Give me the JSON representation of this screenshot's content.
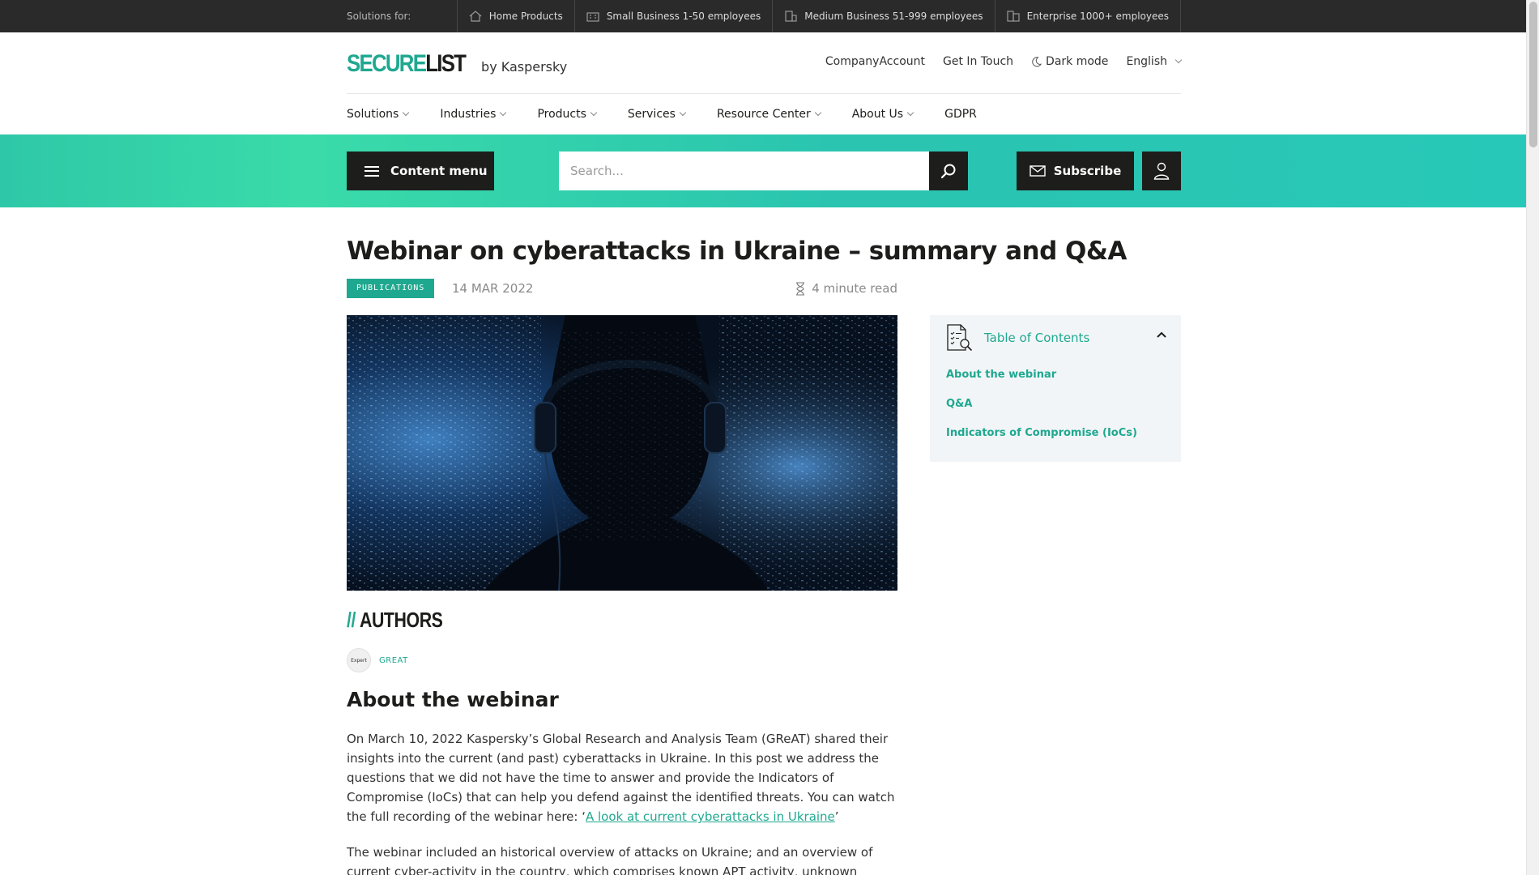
{
  "topbar": {
    "label": "Solutions for:",
    "items": [
      {
        "label": "Home Products",
        "icon": "house-icon"
      },
      {
        "label": "Small Business 1-50 employees",
        "icon": "building-small-icon"
      },
      {
        "label": "Medium Business 51-999 employees",
        "icon": "building-medium-icon"
      },
      {
        "label": "Enterprise 1000+ employees",
        "icon": "building-large-icon"
      }
    ]
  },
  "header": {
    "logo_part1": "SECURE",
    "logo_part2": "LIST",
    "logo_by": "by Kaspersky",
    "links": {
      "company_account": "CompanyAccount",
      "get_in_touch": "Get In Touch",
      "dark_mode": "Dark mode",
      "language": "English"
    }
  },
  "nav": {
    "items": [
      "Solutions",
      "Industries",
      "Products",
      "Services",
      "Resource Center",
      "About Us",
      "GDPR"
    ]
  },
  "toolbar": {
    "content_menu": "Content menu",
    "search_placeholder": "Search...",
    "subscribe": "Subscribe"
  },
  "article": {
    "title": "Webinar on cyberattacks in Ukraine – summary and Q&A",
    "category": "PUBLICATIONS",
    "date": "14 MAR 2022",
    "read_time": "4 minute read",
    "authors_heading": "AUTHORS",
    "authors_slashes": "//",
    "author_avatar_text": "Expert",
    "author_name": "GREAT",
    "section_heading": "About the webinar",
    "para1_text": "On March 10, 2022 Kaspersky’s Global Research and Analysis Team (GReAT) shared their insights into the current (and past) cyberattacks in Ukraine. In this post we address the questions that we did not have the time to answer and provide the Indicators of Compromise (IoCs) that can help you defend against the identified threats. You can watch the full recording of the webinar here: ‘",
    "para1_link": "A look at current cyberattacks in Ukraine",
    "para1_end": "’",
    "para2_text": "The webinar included an historical overview of attacks on Ukraine; and an overview of current cyber-activity in the country, which comprises known APT activity, unknown parties carrying out"
  },
  "toc": {
    "title": "Table of Contents",
    "items": [
      "About the webinar",
      "Q&A",
      "Indicators of Compromise (IoCs)"
    ]
  },
  "colors": {
    "accent": "#1fa890",
    "dark": "#1d1d1b",
    "band": "#2ec8a8"
  }
}
